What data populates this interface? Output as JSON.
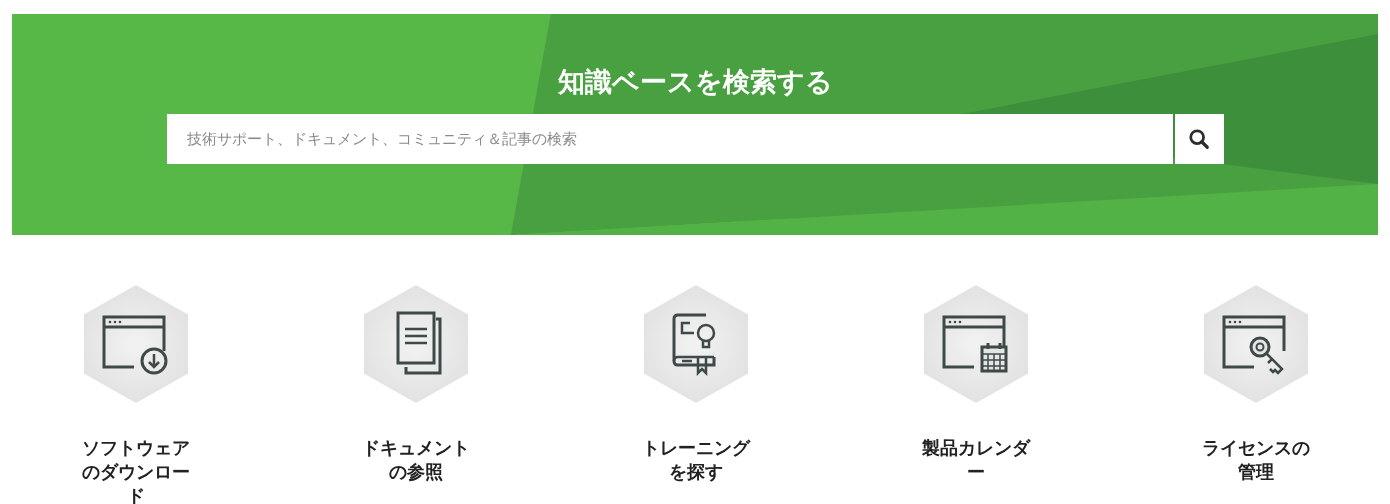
{
  "banner": {
    "title": "知識ベースを検索する",
    "search": {
      "placeholder": "技術サポート、ドキュメント、コミュニティ＆記事の検索"
    }
  },
  "links": [
    {
      "kind": "download",
      "label": "ソフトウェアのダウンロード"
    },
    {
      "kind": "documents",
      "label": "ドキュメントの参照"
    },
    {
      "kind": "training",
      "label": "トレーニングを探す"
    },
    {
      "kind": "calendar",
      "label": "製品カレンダー"
    },
    {
      "kind": "license",
      "label": "ライセンスの管理"
    }
  ]
}
